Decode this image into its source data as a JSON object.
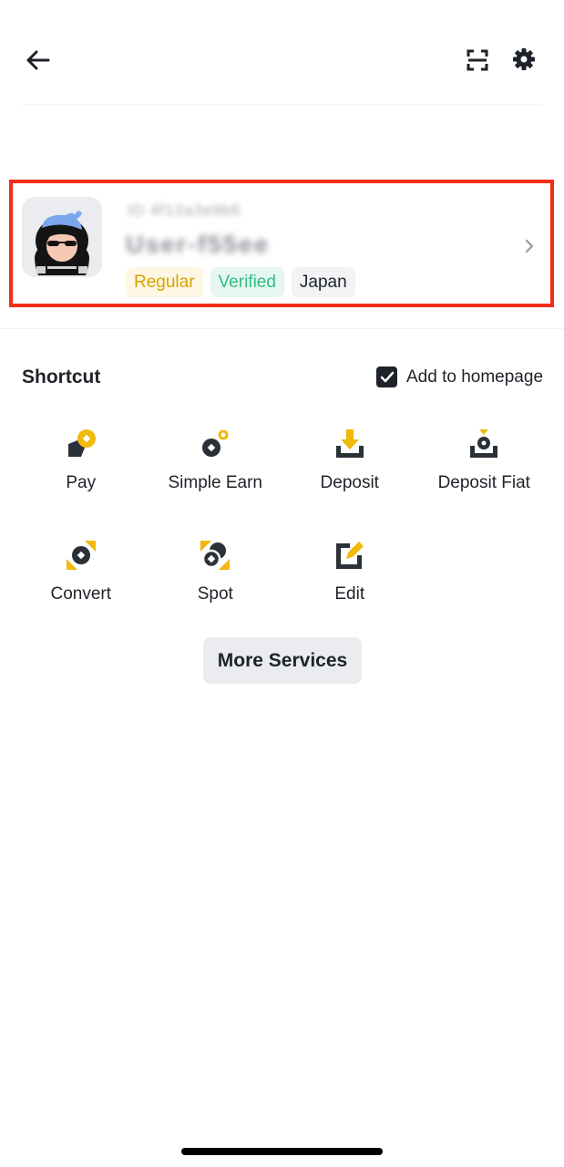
{
  "profile": {
    "uid_text": "ID 4f12a3e9b6",
    "username": "User-f55ee",
    "tags": [
      "Regular",
      "Verified",
      "Japan"
    ]
  },
  "shortcut": {
    "title": "Shortcut",
    "add_to_homepage_label": "Add to homepage",
    "add_to_homepage_checked": true,
    "items": [
      {
        "label": "Pay",
        "icon": "pay-icon"
      },
      {
        "label": "Simple Earn",
        "icon": "simple-earn-icon"
      },
      {
        "label": "Deposit",
        "icon": "deposit-icon"
      },
      {
        "label": "Deposit Fiat",
        "icon": "deposit-fiat-icon"
      },
      {
        "label": "Convert",
        "icon": "convert-icon"
      },
      {
        "label": "Spot",
        "icon": "spot-icon"
      },
      {
        "label": "Edit",
        "icon": "edit-icon"
      }
    ]
  },
  "more_services_label": "More Services",
  "colors": {
    "accent_yellow": "#f0b90b",
    "dark": "#1e2329",
    "highlight_border": "#f52d16",
    "verified_green": "#2ebd85"
  }
}
